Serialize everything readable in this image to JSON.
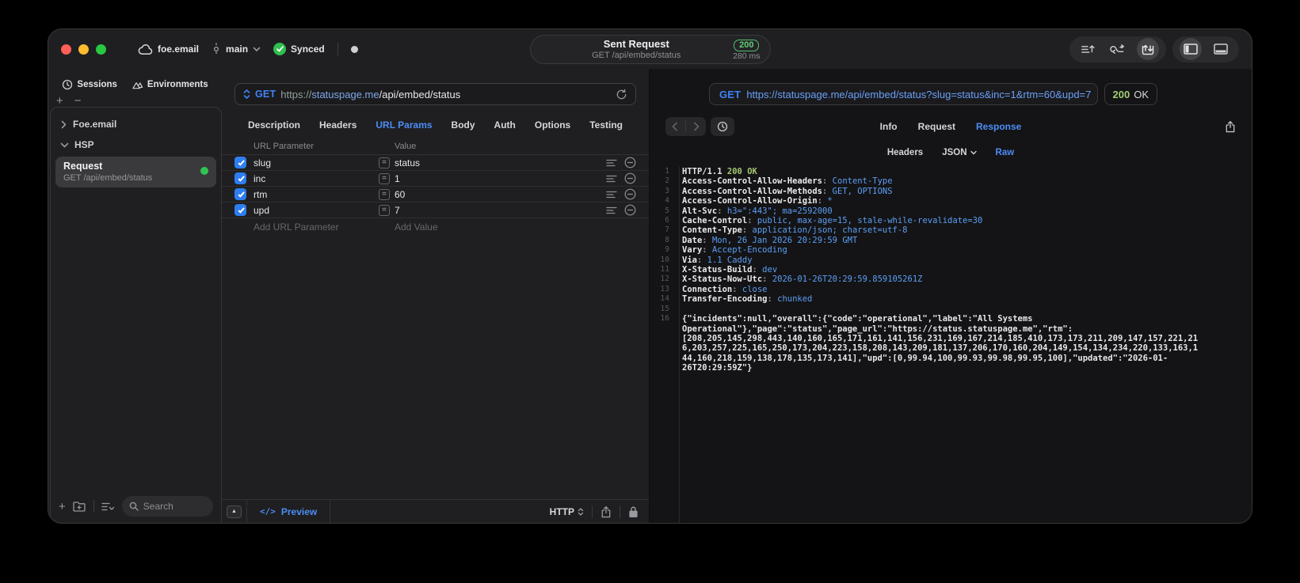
{
  "titlebar": {
    "project": "foe.email",
    "branch": "main",
    "sync_status": "Synced",
    "request": {
      "title": "Sent Request",
      "subtitle": "GET /api/embed/status",
      "status_code": "200",
      "duration": "280 ms"
    }
  },
  "sidebar": {
    "tabs": [
      {
        "label": "Sessions",
        "icon": "history-icon"
      },
      {
        "label": "Environments",
        "icon": "environments-icon"
      }
    ],
    "tree": [
      {
        "label": "Foe.email",
        "expanded": false
      },
      {
        "label": "HSP",
        "expanded": true
      }
    ],
    "request_item": {
      "title": "Request",
      "subtitle": "GET /api/embed/status",
      "status": "success"
    },
    "search_placeholder": "Search"
  },
  "request_panel": {
    "method": "GET",
    "url": {
      "scheme": "https://",
      "host": "statuspage.me",
      "path": "/api/embed/status"
    },
    "tabs": [
      "Description",
      "Headers",
      "URL Params",
      "Body",
      "Auth",
      "Options",
      "Testing"
    ],
    "active_tab": "URL Params",
    "params_table": {
      "columns": [
        "URL Parameter",
        "Value"
      ],
      "operator": "=",
      "rows": [
        {
          "checked": true,
          "name": "slug",
          "value": "status"
        },
        {
          "checked": true,
          "name": "inc",
          "value": "1"
        },
        {
          "checked": true,
          "name": "rtm",
          "value": "60"
        },
        {
          "checked": true,
          "name": "upd",
          "value": "7"
        }
      ],
      "add_name_placeholder": "Add URL Parameter",
      "add_value_placeholder": "Add Value"
    },
    "footer": {
      "collapse_glyph": "▲",
      "code_glyph": "</>",
      "preview_label": "Preview",
      "protocol": "HTTP"
    }
  },
  "response_panel": {
    "method": "GET",
    "url": "https://statuspage.me/api/embed/status?slug=status&inc=1&rtm=60&upd=7",
    "status_code": "200",
    "status_text": "OK",
    "tabs": [
      {
        "label": "Info"
      },
      {
        "label": "Request"
      },
      {
        "label": "Response",
        "active": true
      }
    ],
    "subtabs": [
      {
        "label": "Headers"
      },
      {
        "label": "JSON",
        "dropdown": true
      },
      {
        "label": "Raw",
        "active": true
      }
    ],
    "code_lines": [
      {
        "n": "1",
        "segs": [
          {
            "t": "HTTP/1.1 ",
            "s": "p"
          },
          {
            "t": "200 OK",
            "s": "g"
          }
        ]
      },
      {
        "n": "2",
        "segs": [
          {
            "t": "Access-Control-Allow-Headers",
            "s": "k"
          },
          {
            "t": ": ",
            "s": "d"
          },
          {
            "t": "Content-Type",
            "s": "v"
          }
        ]
      },
      {
        "n": "3",
        "segs": [
          {
            "t": "Access-Control-Allow-Methods",
            "s": "k"
          },
          {
            "t": ": ",
            "s": "d"
          },
          {
            "t": "GET, OPTIONS",
            "s": "v"
          }
        ]
      },
      {
        "n": "4",
        "segs": [
          {
            "t": "Access-Control-Allow-Origin",
            "s": "k"
          },
          {
            "t": ": ",
            "s": "d"
          },
          {
            "t": "*",
            "s": "v"
          }
        ]
      },
      {
        "n": "5",
        "segs": [
          {
            "t": "Alt-Svc",
            "s": "k"
          },
          {
            "t": ": ",
            "s": "d"
          },
          {
            "t": "h3=\":443\"; ma=2592000",
            "s": "v"
          }
        ]
      },
      {
        "n": "6",
        "segs": [
          {
            "t": "Cache-Control",
            "s": "k"
          },
          {
            "t": ": ",
            "s": "d"
          },
          {
            "t": "public, max-age=15, stale-while-revalidate=30",
            "s": "v"
          }
        ]
      },
      {
        "n": "7",
        "segs": [
          {
            "t": "Content-Type",
            "s": "k"
          },
          {
            "t": ": ",
            "s": "d"
          },
          {
            "t": "application/json; charset=utf-8",
            "s": "v"
          }
        ]
      },
      {
        "n": "8",
        "segs": [
          {
            "t": "Date",
            "s": "k"
          },
          {
            "t": ": ",
            "s": "d"
          },
          {
            "t": "Mon, 26 Jan 2026 20:29:59 GMT",
            "s": "v"
          }
        ]
      },
      {
        "n": "9",
        "segs": [
          {
            "t": "Vary",
            "s": "k"
          },
          {
            "t": ": ",
            "s": "d"
          },
          {
            "t": "Accept-Encoding",
            "s": "v"
          }
        ]
      },
      {
        "n": "10",
        "segs": [
          {
            "t": "Via",
            "s": "k"
          },
          {
            "t": ": ",
            "s": "d"
          },
          {
            "t": "1.1 Caddy",
            "s": "v"
          }
        ]
      },
      {
        "n": "11",
        "segs": [
          {
            "t": "X-Status-Build",
            "s": "k"
          },
          {
            "t": ": ",
            "s": "d"
          },
          {
            "t": "dev",
            "s": "v"
          }
        ]
      },
      {
        "n": "12",
        "segs": [
          {
            "t": "X-Status-Now-Utc",
            "s": "k"
          },
          {
            "t": ": ",
            "s": "d"
          },
          {
            "t": "2026-01-26T20:29:59.859105261Z",
            "s": "v"
          }
        ]
      },
      {
        "n": "13",
        "segs": [
          {
            "t": "Connection",
            "s": "k"
          },
          {
            "t": ": ",
            "s": "d"
          },
          {
            "t": "close",
            "s": "v"
          }
        ]
      },
      {
        "n": "14",
        "segs": [
          {
            "t": "Transfer-Encoding",
            "s": "k"
          },
          {
            "t": ": ",
            "s": "d"
          },
          {
            "t": "chunked",
            "s": "v"
          }
        ]
      },
      {
        "n": "15",
        "segs": []
      },
      {
        "n": "16",
        "segs": [
          {
            "t": "{\"incidents\":null,\"overall\":{\"code\":\"operational\",\"label\":\"All Systems Operational\"},\"page\":\"status\",\"page_url\":\"https://status.statuspage.me\",\"rtm\":[208,205,145,298,443,140,160,165,171,161,141,156,231,169,167,214,185,410,173,173,211,209,147,157,221,216,203,257,225,165,250,173,204,223,158,208,143,209,181,137,206,170,160,204,149,154,134,234,220,133,163,144,160,218,159,138,178,135,173,141],\"upd\":[0,99.94,100,99.93,99.98,99.95,100],\"updated\":\"2026-01-26T20:29:59Z\"}",
            "s": "p"
          }
        ]
      }
    ]
  },
  "icons": {
    "plus": "+",
    "minus": "−"
  },
  "colors": {
    "accent_blue": "#4c8df6",
    "method_blue": "#3f82f7",
    "success_green": "#30c553",
    "badge_green": "#5ac46a",
    "code_value_blue": "#5c9ff5",
    "code_green": "#a6c772",
    "checkbox_blue": "#2e7ef0"
  }
}
